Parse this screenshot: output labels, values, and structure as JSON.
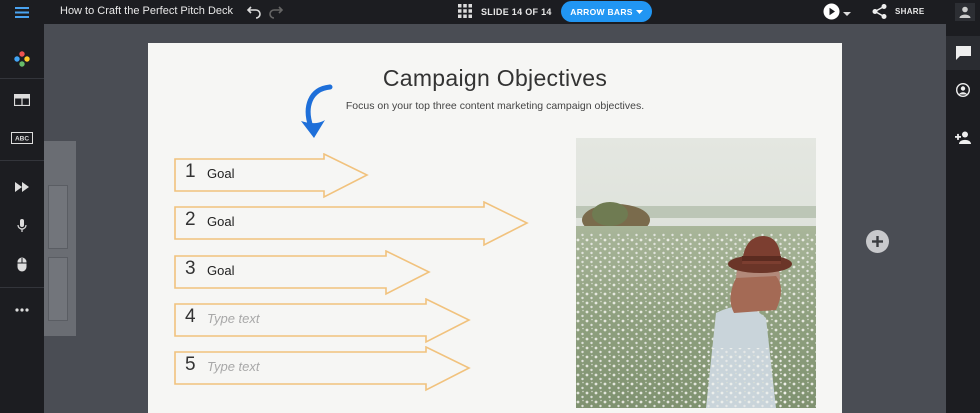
{
  "header": {
    "title": "How to Craft the Perfect Pitch Deck",
    "slide_counter": "SLIDE 14 OF 14",
    "template_button_label": "ARROW BARS",
    "share_label": "SHARE"
  },
  "slide": {
    "title": "Campaign Objectives",
    "subtitle": "Focus on your top three content marketing campaign objectives.",
    "goals": [
      {
        "number": "1",
        "label": "Goal",
        "placeholder": false
      },
      {
        "number": "2",
        "label": "Goal",
        "placeholder": false
      },
      {
        "number": "3",
        "label": "Goal",
        "placeholder": false
      },
      {
        "number": "4",
        "label": "Type text",
        "placeholder": true
      },
      {
        "number": "5",
        "label": "Type text",
        "placeholder": true
      }
    ]
  },
  "left_sidebar": {
    "items": [
      {
        "icon": "palette-icon"
      },
      {
        "icon": "layout-icon"
      },
      {
        "icon": "text-icon",
        "label": "ABC"
      },
      {
        "icon": "animation-icon"
      },
      {
        "icon": "microphone-icon"
      },
      {
        "icon": "mouse-icon"
      },
      {
        "icon": "more-icon"
      }
    ]
  },
  "right_sidebar": {
    "items": [
      {
        "icon": "comment-icon"
      },
      {
        "icon": "account-icon"
      },
      {
        "icon": "add-person-icon"
      }
    ]
  },
  "colors": {
    "accent": "#2196f3",
    "chrome": "#1c1d21",
    "canvas": "#4a4d54",
    "arrow_outline": "#f1c27d"
  }
}
